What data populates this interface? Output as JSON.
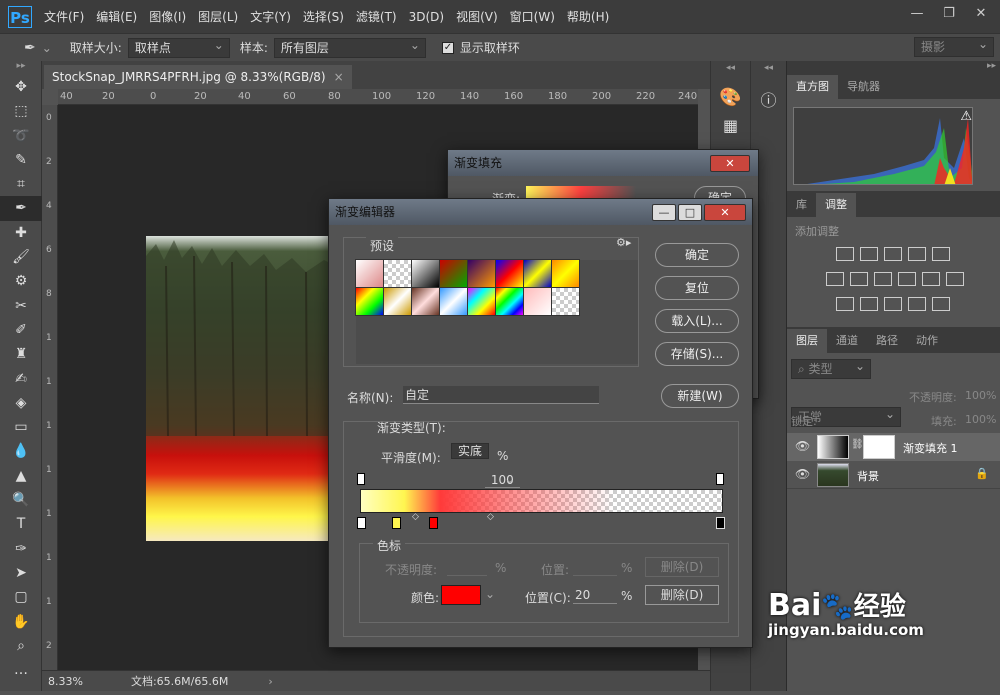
{
  "app": {
    "logo": "Ps",
    "menu": [
      "文件(F)",
      "编辑(E)",
      "图像(I)",
      "图层(L)",
      "文字(Y)",
      "选择(S)",
      "滤镜(T)",
      "3D(D)",
      "视图(V)",
      "窗口(W)",
      "帮助(H)"
    ]
  },
  "options": {
    "sample_size_label": "取样大小:",
    "sample_size_value": "取样点",
    "sample_label": "样本:",
    "sample_value": "所有图层",
    "show_ring_label": "显示取样环",
    "workspace": "摄影"
  },
  "document": {
    "tab_title": "StockSnap_JMRRS4PFRH.jpg @ 8.33%(RGB/8)",
    "ruler_h": [
      "40",
      "20",
      "0",
      "20",
      "40",
      "60",
      "80",
      "100",
      "120",
      "140",
      "160",
      "180",
      "200",
      "220",
      "240"
    ],
    "ruler_v": [
      "0",
      "2",
      "4",
      "6",
      "8",
      "1",
      "1",
      "1",
      "1",
      "1",
      "1",
      "1",
      "2"
    ],
    "zoom": "8.33%",
    "doc_info": "文档:65.6M/65.6M"
  },
  "panels": {
    "histogram_tabs": [
      "直方图",
      "导航器"
    ],
    "adjust_tabs": [
      "库",
      "调整"
    ],
    "adjust_title": "添加调整",
    "layers_tabs": [
      "图层",
      "通道",
      "路径",
      "动作"
    ],
    "kind_label": "类型",
    "blend_mode": "正常",
    "opacity_label": "不透明度:",
    "opacity_value": "100%",
    "lock_label": "锁定:",
    "fill_label": "填充:",
    "fill_value": "100%",
    "layers": [
      {
        "name": "渐变填充 1"
      },
      {
        "name": "背景"
      }
    ]
  },
  "gradient_fill_dialog": {
    "title": "渐变填充",
    "row_label": "渐变:",
    "ok": "确定"
  },
  "gradient_editor": {
    "title": "渐变编辑器",
    "presets_label": "预设",
    "buttons": {
      "ok": "确定",
      "reset": "复位",
      "load": "载入(L)...",
      "save": "存储(S)...",
      "new": "新建(W)"
    },
    "name_label": "名称(N):",
    "name_value": "自定",
    "type_label": "渐变类型(T):",
    "type_value": "实底",
    "smooth_label": "平滑度(M):",
    "smooth_value": "100",
    "smooth_unit": "%",
    "stops": {
      "group_label": "色标",
      "opacity_label": "不透明度:",
      "opacity_unit": "%",
      "position_label": "位置:",
      "position_unit": "%",
      "delete": "删除(D)",
      "color_label": "颜色:",
      "color_value": "#ff0000",
      "position2_label": "位置(C):",
      "position2_value": "20",
      "delete2": "删除(D)"
    }
  },
  "watermark": {
    "brand": "Bai",
    "brand2": "经验",
    "url": "jingyan.baidu.com"
  }
}
